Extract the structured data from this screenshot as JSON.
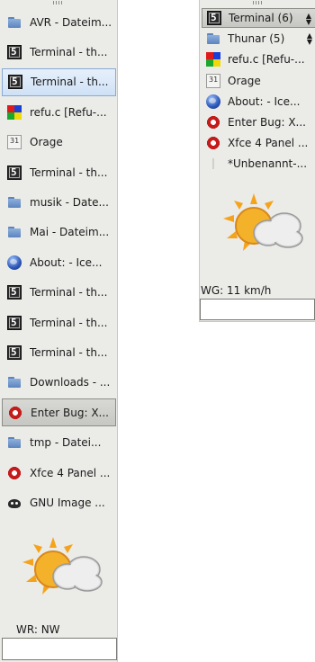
{
  "left_panel": {
    "tasks": [
      {
        "label": "AVR - Dateim...",
        "icon": "folder-icon"
      },
      {
        "label": "Terminal - th...",
        "icon": "terminal-icon"
      },
      {
        "label": "Terminal - th...",
        "icon": "terminal-icon",
        "state": "active"
      },
      {
        "label": "refu.c [Refu-...",
        "icon": "editor-icon"
      },
      {
        "label": "Orage",
        "icon": "calendar-icon"
      },
      {
        "label": "Terminal - th...",
        "icon": "terminal-icon"
      },
      {
        "label": "musik - Date...",
        "icon": "folder-icon"
      },
      {
        "label": "Mai - Dateim...",
        "icon": "folder-icon"
      },
      {
        "label": "About: - Ice...",
        "icon": "globe-icon"
      },
      {
        "label": "Terminal - th...",
        "icon": "terminal-icon"
      },
      {
        "label": "Terminal - th...",
        "icon": "terminal-icon"
      },
      {
        "label": "Terminal - th...",
        "icon": "terminal-icon"
      },
      {
        "label": "Downloads - ...",
        "icon": "folder-icon"
      },
      {
        "label": "Enter Bug: X...",
        "icon": "opera-icon",
        "state": "pressed"
      },
      {
        "label": "tmp - Datei...",
        "icon": "folder-icon"
      },
      {
        "label": "Xfce 4 Panel ...",
        "icon": "opera-icon"
      },
      {
        "label": "GNU Image ...",
        "icon": "gimp-icon"
      }
    ],
    "weather_icon": "sun-behind-cloud-icon",
    "wind_label": "WR: NW",
    "entry_value": ""
  },
  "right_panel": {
    "tasks": [
      {
        "label": "Terminal (6)",
        "icon": "terminal-icon",
        "state": "group"
      },
      {
        "label": "Thunar (5)",
        "icon": "folder-icon",
        "state": "group-collapsed"
      },
      {
        "label": "refu.c [Refu-...",
        "icon": "editor-icon"
      },
      {
        "label": "Orage",
        "icon": "calendar-icon"
      },
      {
        "label": "About: - Ice...",
        "icon": "globe-icon"
      },
      {
        "label": "Enter Bug: X...",
        "icon": "opera-icon"
      },
      {
        "label": "Xfce 4 Panel ...",
        "icon": "opera-icon"
      },
      {
        "label": "*Unbenannt-...",
        "icon": "note-icon"
      }
    ],
    "weather_icon": "sun-behind-cloud-icon",
    "wind_label": "WG: 11 km/h",
    "entry_value": ""
  },
  "calendar_icon_text": "31",
  "terminal_icon_text": "5",
  "colors": {
    "panel": "#ebebe8",
    "active_border": "#86aad6",
    "sun": "#f5a31a",
    "cloud": "#e4e4e4"
  }
}
